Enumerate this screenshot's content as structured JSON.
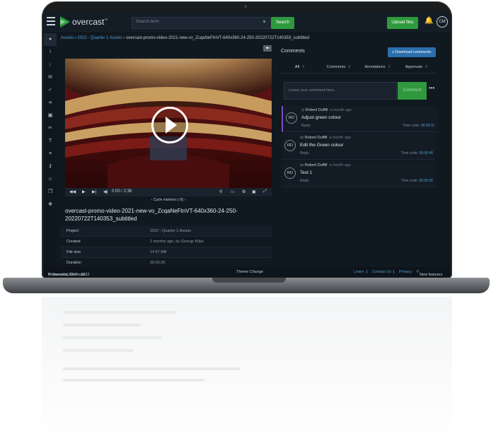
{
  "app": {
    "logo_text": "overcast",
    "logo_mark": "™"
  },
  "header": {
    "search_placeholder": "Search term",
    "search_button": "Search",
    "upload_button": "Upload files",
    "user_initials": "CM"
  },
  "breadcrumb": {
    "root": "Assets",
    "folder": "2022 - Quarter 1 Assets",
    "file": "overcast-promo-video-2021-new-vo_ZcqaNeFtnVT-640x360-24-250-20220722T140353_subtitled",
    "separator": "›"
  },
  "player": {
    "current_time": "0:00",
    "duration": "2:36",
    "time_sep": "/",
    "cycle_label": "Cycle markers",
    "cycle_count": "(-/3)"
  },
  "asset": {
    "title": "overcast-promo-video-2021-new-vo_ZcqaNeFtnVT-640x360-24-250-20220722T140353_subtitled",
    "meta": [
      {
        "key": "Project",
        "value": "2022 - Quarter 1 Assets"
      },
      {
        "key": "Created",
        "value": "2 months ago, by George Kilpa"
      },
      {
        "key": "File size",
        "value": "14.67 MB"
      },
      {
        "key": "Duration",
        "value": "00:02:36"
      }
    ]
  },
  "comments_panel": {
    "heading": "Comments",
    "download_button": "Download comments",
    "tabs": [
      {
        "label": "All",
        "count": "3"
      },
      {
        "label": "Comments",
        "count": "2"
      },
      {
        "label": "Annotations",
        "count": "1"
      },
      {
        "label": "Approvals",
        "count": "0"
      }
    ],
    "input_placeholder": "Leave your comment here...",
    "submit_button": "Comment",
    "items": [
      {
        "initials": "RD",
        "author": "Robert Duffill",
        "time": "a month ago",
        "text": "Adjust green colour",
        "reply": "Reply",
        "timecode_label": "Time code:",
        "timecode": "00:03:11"
      },
      {
        "initials": "RD",
        "author": "Robert Duffill",
        "time": "a month ago",
        "text": "Edit the Green colour",
        "reply": "Reply",
        "timecode_label": "Time code:",
        "timecode": "00:00:46"
      },
      {
        "initials": "RD",
        "author": "Robert Duffill",
        "time": "a month ago",
        "text": "Test 1",
        "reply": "Reply",
        "timecode_label": "Time code:",
        "timecode": "00:00:35"
      }
    ]
  },
  "footer": {
    "powered": "Powered by Overcast",
    "copyright": "© Overcast 2017 - 2022",
    "theme": "Theme Change",
    "learn": "Learn",
    "contact": "Contact Us",
    "privacy": "Privacy",
    "new_features": "New features",
    "divider": "|"
  },
  "colors": {
    "accent_green": "#2f9a3d",
    "link_blue": "#4d9fd6",
    "background": "#101820"
  }
}
